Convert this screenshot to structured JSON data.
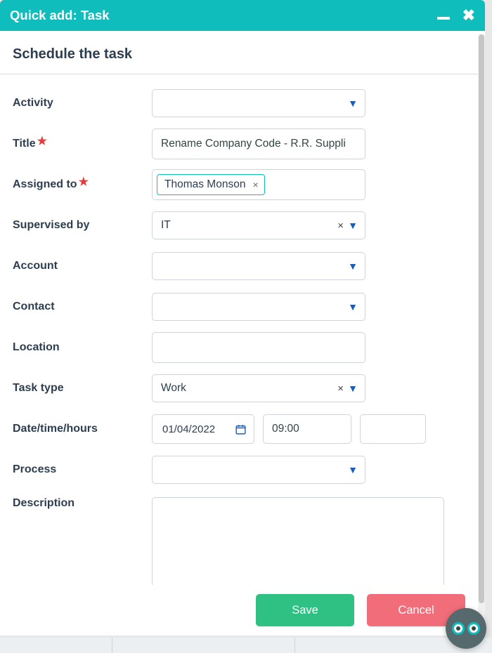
{
  "header": {
    "title": "Quick add: Task"
  },
  "section_title": "Schedule the task",
  "labels": {
    "activity": "Activity",
    "title": "Title",
    "assigned_to": "Assigned to",
    "supervised_by": "Supervised by",
    "account": "Account",
    "contact": "Contact",
    "location": "Location",
    "task_type": "Task type",
    "datetime": "Date/time/hours",
    "process": "Process",
    "description": "Description"
  },
  "fields": {
    "activity": "",
    "title": "Rename Company Code - R.R. Suppli",
    "assigned_to": [
      {
        "name": "Thomas Monson"
      }
    ],
    "supervised_by": "IT",
    "account": "",
    "contact": "",
    "location": "",
    "task_type": "Work",
    "date": "01/04/2022",
    "time": "09:00",
    "hours": "",
    "process": "",
    "description": ""
  },
  "buttons": {
    "save": "Save",
    "cancel": "Cancel"
  }
}
